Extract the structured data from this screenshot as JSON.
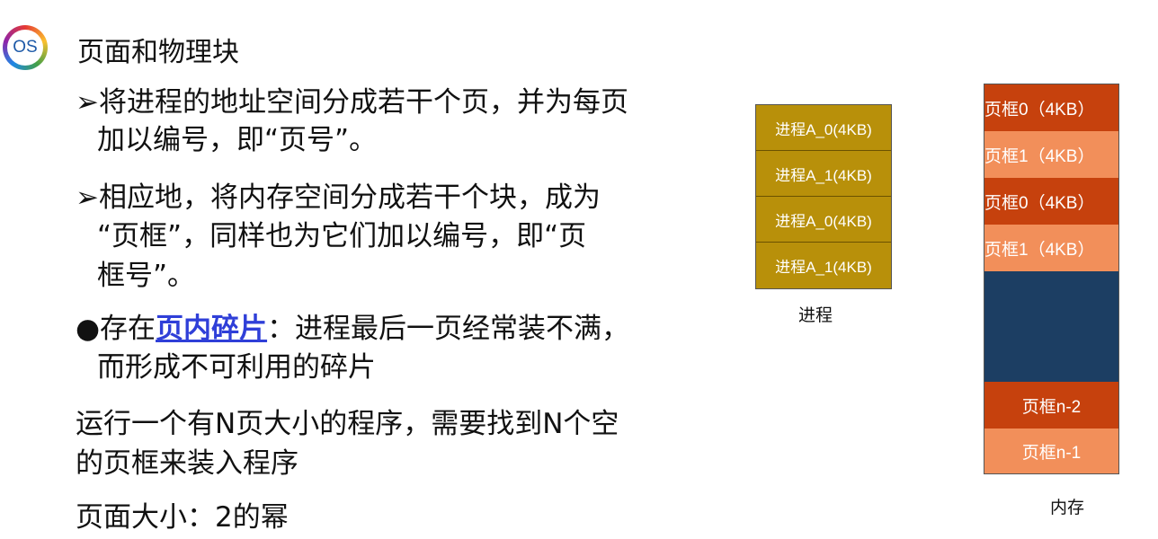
{
  "logo": {
    "text": "OS"
  },
  "title": "页面和物理块",
  "bullets": {
    "b1_line1": "➢将进程的地址空间分成若干个页，并为每页",
    "b1_line2": "加以编号，即“页号”。",
    "b2_line1": "➢相应地，将内存空间分成若干个块，成为",
    "b2_line2": "“页框”，同样也为它们加以编号，即“页",
    "b2_line3": "框号”。",
    "b3_prefix": "●存在",
    "b3_link": "页内碎片",
    "b3_suffix": "：进程最后一页经常装不满，",
    "b3_line2": "而形成不可利用的碎片"
  },
  "para1_line1": "运行一个有N页大小的程序，需要找到N个空",
  "para1_line2": "的页框来装入程序",
  "para2": "页面大小：2的幂",
  "process": {
    "label": "进程",
    "cells": [
      "进程A_0(4KB)",
      "进程A_1(4KB)",
      "进程A_0(4KB)",
      "进程A_1(4KB)"
    ]
  },
  "memory": {
    "label": "内存",
    "cells": [
      "页框0（4KB）",
      "页框1（4KB）",
      "页框0（4KB）",
      "页框1（4KB）",
      "页框n-2",
      "页框n-1"
    ]
  },
  "colors": {
    "process_cell": "#b8900a",
    "frame_dark": "#c6410d",
    "frame_light": "#f28f5a",
    "memory_free": "#1c3e63",
    "link": "#2f3fd8"
  }
}
